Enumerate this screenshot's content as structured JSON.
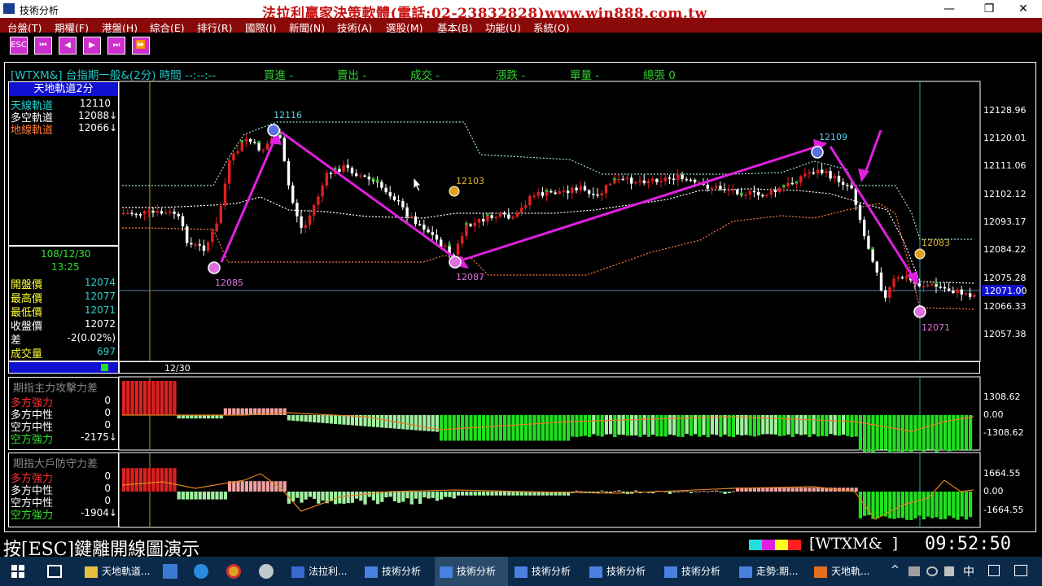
{
  "window": {
    "title": "技術分析",
    "banner": "法拉利贏家決策軟體(電話:02-23832828)www.win888.com.tw",
    "minimize": "—",
    "maximize": "❐",
    "close": "✕"
  },
  "menu": [
    "台盤(T)",
    "期權(F)",
    "港盤(H)",
    "綜合(E)",
    "排行(R)",
    "國際(I)",
    "新聞(N)",
    "技術(A)",
    "選股(M)",
    "基本(B)",
    "功能(U)",
    "系統(O)"
  ],
  "toolbar": {
    "esc": "ESC",
    "first": "⏮",
    "prev": "◀",
    "next": "▶",
    "last": "⏭",
    "fast": "⏩"
  },
  "info_bar": {
    "symbol_name": "[WTXM&] 台指期一般&(2分) 時間 --:--:--",
    "buy": "買進 -",
    "sell": "賣出 -",
    "deal": "成交 -",
    "change": "漲跌 -",
    "volume": "單量 -",
    "total": "總張 0"
  },
  "indicator_panel": {
    "title": "天地軌道2分",
    "rows": [
      {
        "label": "天線軌道",
        "value": "12110",
        "color": "#22d0d0"
      },
      {
        "label": "多空軌道",
        "value": "12088↓",
        "color": "#ffffff"
      },
      {
        "label": "地線軌道",
        "value": "12066↓",
        "color": "#ff7a30"
      }
    ]
  },
  "quote_panel": {
    "date": "108/12/30",
    "time": "13:25",
    "rows": [
      {
        "label": "開盤價",
        "value": "12074",
        "color": "#ffff30"
      },
      {
        "label": "最高價",
        "value": "12077",
        "color": "#ffff30"
      },
      {
        "label": "最低價",
        "value": "12071",
        "color": "#ffff30"
      },
      {
        "label": "收盤價",
        "value": "12072",
        "color": "#ffffff"
      },
      {
        "label": "差",
        "value": "-2(0.02%)",
        "color": "#ffffff"
      },
      {
        "label": "成交量",
        "value": "697",
        "color": "#ffff30"
      }
    ]
  },
  "main_chart": {
    "y_ticks": [
      "12128.96",
      "12120.01",
      "12111.06",
      "12102.12",
      "12093.17",
      "12084.22",
      "12075.28",
      "12071.00",
      "12066.33",
      "12057.38"
    ],
    "x_label": "12/30",
    "annotations": [
      "12116",
      "12085",
      "12103",
      "12087",
      "12109",
      "12083",
      "12071"
    ]
  },
  "sub1": {
    "title": "期指主力攻擊力差",
    "rows": [
      {
        "label": "多方強力",
        "value": "0",
        "color": "#ff3030"
      },
      {
        "label": "多方中性",
        "value": "0",
        "color": "#ffffff"
      },
      {
        "label": "空方中性",
        "value": "0",
        "color": "#ffffff"
      },
      {
        "label": "空方強力",
        "value": "-2175↓",
        "color": "#30e030"
      }
    ],
    "y_ticks": [
      "1308.62",
      "0.00",
      "-1308.62"
    ]
  },
  "sub2": {
    "title": "期指大戶防守力差",
    "rows": [
      {
        "label": "多方強力",
        "value": "0",
        "color": "#ff3030"
      },
      {
        "label": "多方中性",
        "value": "0",
        "color": "#ffffff"
      },
      {
        "label": "空方中性",
        "value": "0",
        "color": "#ffffff"
      },
      {
        "label": "空方強力",
        "value": "-1904↓",
        "color": "#30e030"
      }
    ],
    "y_ticks": [
      "1664.55",
      "0.00",
      "-1664.55"
    ]
  },
  "status_bar": {
    "hint": "按[ESC]鍵離開線圖演示",
    "symbol": "[WTXM&  ]",
    "clock": "09:52:50"
  },
  "taskbar": {
    "items": [
      "天地軌道...",
      "法拉利...",
      "技術分析",
      "技術分析",
      "技術分析",
      "技術分析",
      "技術分析",
      "走勢:期...",
      "天地軌..."
    ],
    "tray": [
      "^",
      "中"
    ]
  }
}
